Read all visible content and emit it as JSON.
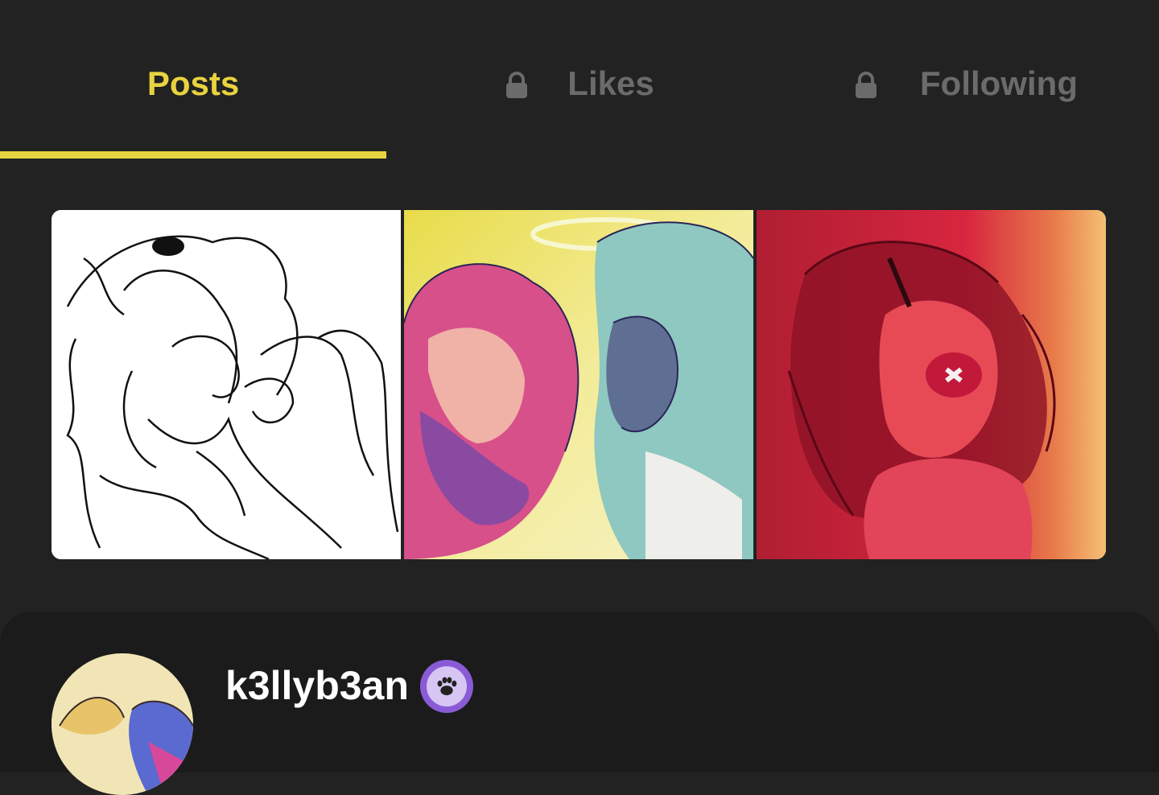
{
  "tabs": {
    "posts_label": "Posts",
    "likes_label": "Likes",
    "following_label": "Following",
    "active": "Posts",
    "active_color": "#e8d33f",
    "inactive_color": "#6b6b6b",
    "lock_icon": "lock-icon"
  },
  "posts": [
    {
      "kind": "line-art-sketch"
    },
    {
      "kind": "watercolor-illustration"
    },
    {
      "kind": "red-painting"
    }
  ],
  "profile": {
    "username": "k3llyb3an",
    "badge_icon": "paw-icon",
    "badge_color": "#8a5bd6"
  },
  "colors": {
    "background": "#222222",
    "accent": "#e8d33f"
  }
}
